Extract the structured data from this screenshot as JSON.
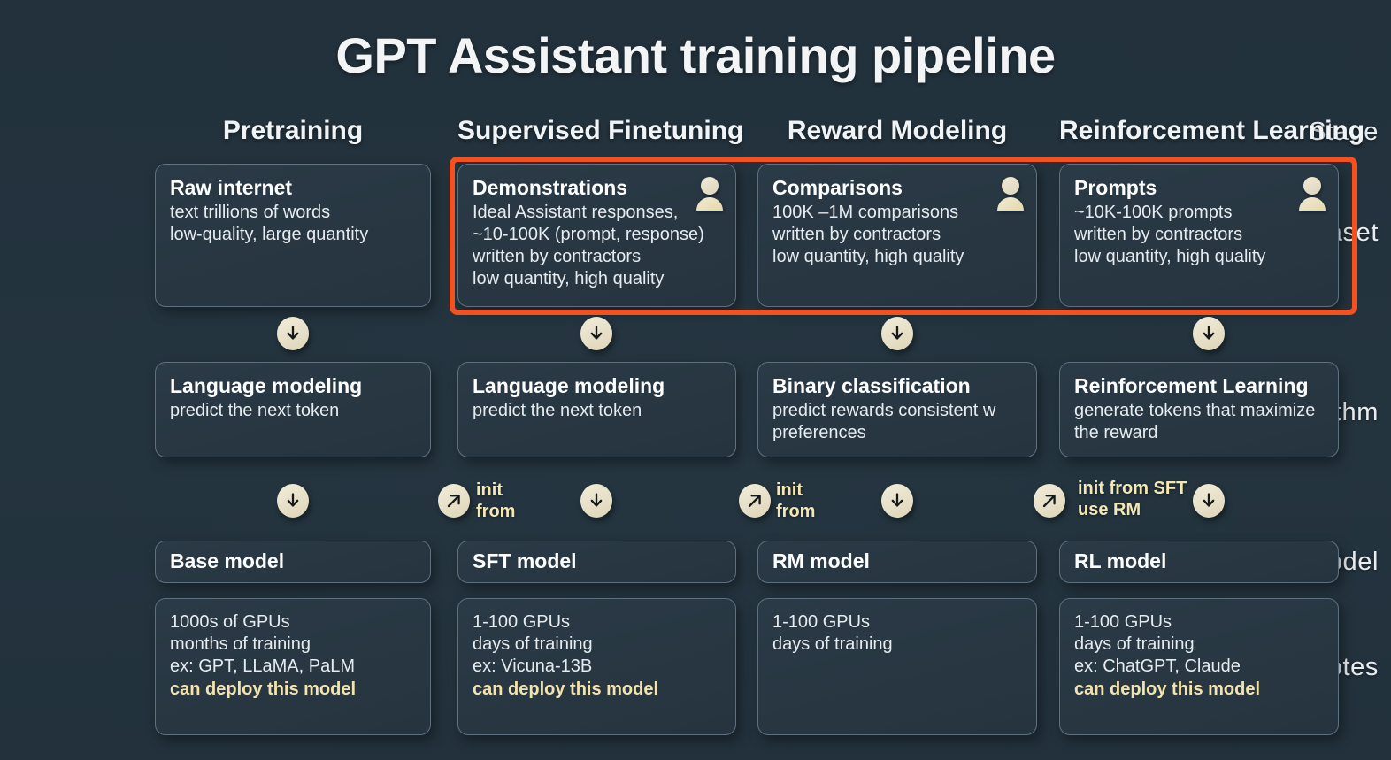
{
  "title": "GPT Assistant training pipeline",
  "row_labels": {
    "stage": "Stage",
    "dataset": "Dataset",
    "algorithm": "Algorithm",
    "model": "Model",
    "notes": "Notes"
  },
  "colors": {
    "background": "#23323d",
    "card_bg": "#283742",
    "card_border": "#5d7180",
    "accent_text": "#f3e4ad",
    "highlight_red": "#f4511e",
    "puck_cream": "#ece5d0",
    "title_text": "#f2f4f6"
  },
  "stages": [
    {
      "name": "Pretraining",
      "dataset": {
        "heading": "Raw internet",
        "lines": [
          "text trillions of words",
          "low-quality, large quantity"
        ],
        "person_icon": false
      },
      "algorithm": {
        "heading": "Language modeling",
        "lines": [
          "predict the next token"
        ]
      },
      "model": {
        "heading": "Base model"
      },
      "notes": {
        "lines": [
          "1000s of GPUs",
          "months of training",
          "ex: GPT, LLaMA, PaLM"
        ],
        "accent_line": "can deploy this model"
      },
      "down_arrow_after_dataset": true,
      "down_arrow_after_algorithm": true,
      "init_arrow": null
    },
    {
      "name": "Supervised Finetuning",
      "dataset": {
        "heading": "Demonstrations",
        "lines": [
          "Ideal Assistant responses,",
          "~10-100K (prompt, response)",
          "written by contractors",
          "low quantity, high quality"
        ],
        "person_icon": true
      },
      "algorithm": {
        "heading": "Language modeling",
        "lines": [
          "predict the next token"
        ]
      },
      "model": {
        "heading": "SFT model"
      },
      "notes": {
        "lines": [
          "1-100 GPUs",
          "days of training",
          "ex: Vicuna-13B"
        ],
        "accent_line": "can deploy this model"
      },
      "down_arrow_after_dataset": true,
      "down_arrow_after_algorithm": true,
      "init_arrow": {
        "icon": "arrow-up-right-icon",
        "lines": [
          "init",
          "from"
        ]
      }
    },
    {
      "name": "Reward Modeling",
      "dataset": {
        "heading": "Comparisons",
        "lines": [
          "100K –1M comparisons",
          "written by contractors",
          "low quantity, high quality"
        ],
        "person_icon": true
      },
      "algorithm": {
        "heading": "Binary classification",
        "lines": [
          "predict rewards consistent w",
          "preferences"
        ]
      },
      "model": {
        "heading": "RM model"
      },
      "notes": {
        "lines": [
          "1-100 GPUs",
          "days of training"
        ],
        "accent_line": ""
      },
      "down_arrow_after_dataset": true,
      "down_arrow_after_algorithm": true,
      "init_arrow": {
        "icon": "arrow-up-right-icon",
        "lines": [
          "init",
          "from"
        ]
      }
    },
    {
      "name": "Reinforcement Learning",
      "dataset": {
        "heading": "Prompts",
        "lines": [
          "~10K-100K prompts",
          "written by contractors",
          "low quantity, high quality"
        ],
        "person_icon": true
      },
      "algorithm": {
        "heading": "Reinforcement Learning",
        "lines": [
          "generate tokens that maximize",
          "the reward"
        ]
      },
      "model": {
        "heading": "RL model"
      },
      "notes": {
        "lines": [
          "1-100 GPUs",
          "days of training",
          "ex: ChatGPT, Claude"
        ],
        "accent_line": "can deploy this model"
      },
      "down_arrow_after_dataset": true,
      "down_arrow_after_algorithm": true,
      "init_arrow": {
        "icon": "arrow-up-right-icon",
        "lines": [
          "init from SFT",
          "use RM"
        ]
      }
    }
  ],
  "highlight": {
    "label": "dataset-highlight-box",
    "covers_stages": [
      "Supervised Finetuning",
      "Reward Modeling",
      "Reinforcement Learning"
    ]
  }
}
